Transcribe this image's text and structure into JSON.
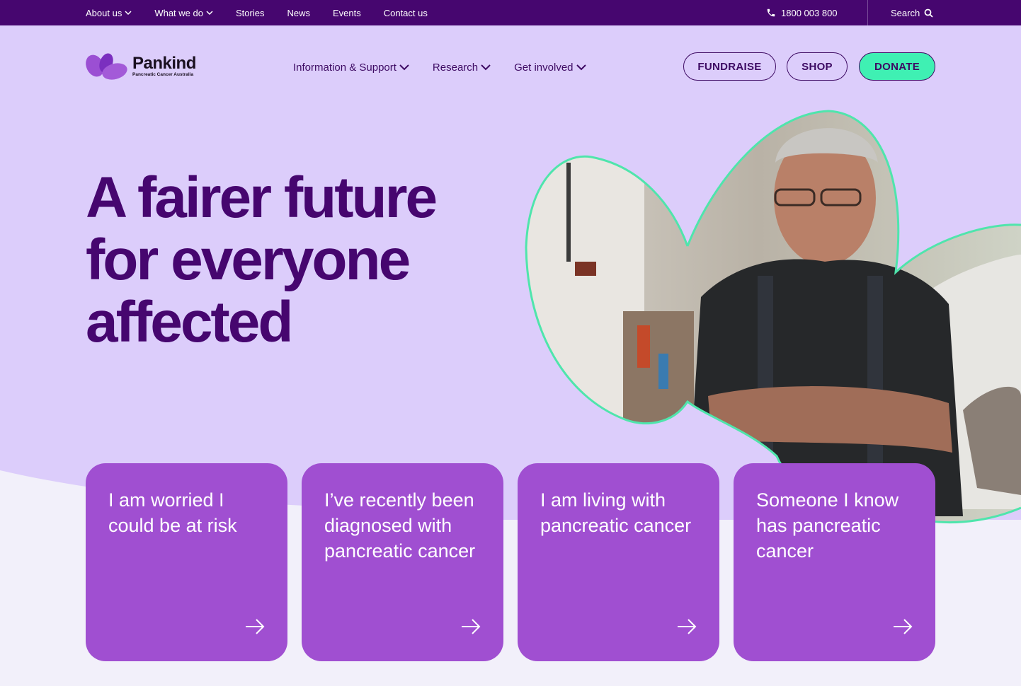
{
  "utility_nav": {
    "links": [
      "About us",
      "What we do",
      "Stories",
      "News",
      "Events",
      "Contact us"
    ],
    "phone": "1800 003 800",
    "search_label": "Search"
  },
  "header": {
    "logo_name": "Pankind",
    "logo_tagline": "Pancreatic Cancer Australia",
    "nav": [
      "Information & Support",
      "Research",
      "Get involved"
    ],
    "buttons": {
      "fundraise": "FUNDRAISE",
      "shop": "SHOP",
      "donate": "DONATE"
    }
  },
  "hero": {
    "headline_lines": [
      "A fairer future",
      "for everyone",
      "affected"
    ]
  },
  "cards": [
    "I am worried I could be at risk",
    "I’ve recently been diagnosed with pancreatic cancer",
    "I am living with pancreatic cancer",
    "Someone I know has pancreatic cancer"
  ],
  "colors": {
    "utility_bg": "#46066f",
    "page_bg": "#dccdfb",
    "lower_bg": "#f2f0fa",
    "headline": "#46066f",
    "card": "#a04fd1",
    "donate": "#3ff0b3",
    "outline": "#4fe5ac"
  }
}
